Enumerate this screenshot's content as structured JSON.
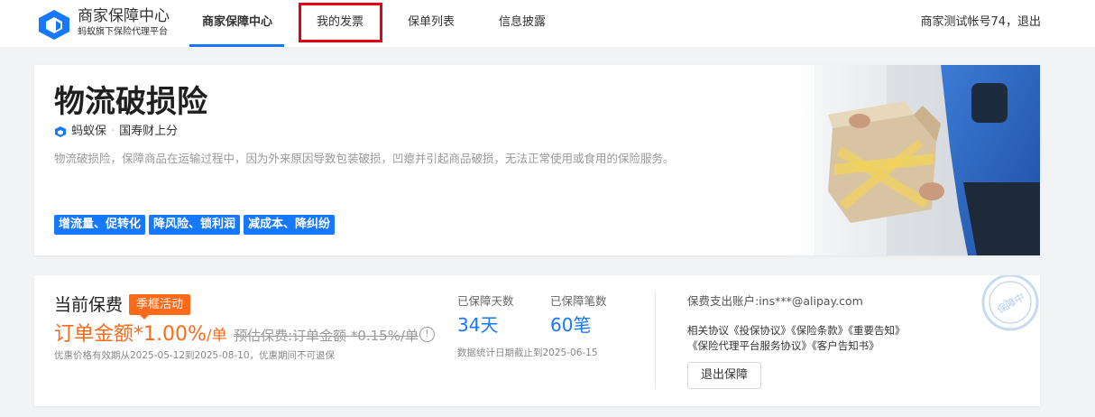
{
  "header": {
    "brand_title": "商家保障中心",
    "brand_subtitle": "蚂蚁旗下保险代理平台",
    "nav": [
      {
        "label": "商家保障中心",
        "active": true
      },
      {
        "label": "我的发票",
        "active": false
      },
      {
        "label": "保单列表",
        "active": false
      },
      {
        "label": "信息披露",
        "active": false
      }
    ],
    "user_text": "商家测试帐号74，退出"
  },
  "hero": {
    "title": "物流破损险",
    "provider_brand": "蚂蚁保",
    "provider_insurer": "国寿财上分",
    "description": "物流破损险，保障商品在运输过程中，因为外来原因导致包装破损，凹瘪并引起商品破损，无法正常使用或食用的保险服务。",
    "tags": [
      "增流量、促转化",
      "降风险、锁利润",
      "减成本、降纠纷"
    ]
  },
  "premium": {
    "title": "当前保费",
    "badge": "季框活动",
    "price_main": "订单金额*1.00%",
    "price_unit": "/单",
    "price_old": "预估保费:订单金额 *0.15%/单",
    "info_icon": "!",
    "promo_note": "优惠价格有效期从2025-05-12到2025-08-10，优惠期间不可退保",
    "stats": [
      {
        "label": "已保障天数",
        "value": "34天"
      },
      {
        "label": "已保障笔数",
        "value": "60笔"
      }
    ],
    "stats_note": "数据统计日期截止到2025-06-15",
    "account": "保费支出账户:ins***@alipay.com",
    "agreements_label": "相关协议",
    "agreements": [
      "《投保协议》",
      "《保险条款》",
      "《重要告知》",
      "《保险代理平台服务协议》",
      "《客户告知书》"
    ],
    "exit_button": "退出保障",
    "stamp_text": "保障中"
  },
  "colors": {
    "accent": "#1677ff",
    "orange": "#ff6a1a",
    "highlight": "#e60012"
  }
}
